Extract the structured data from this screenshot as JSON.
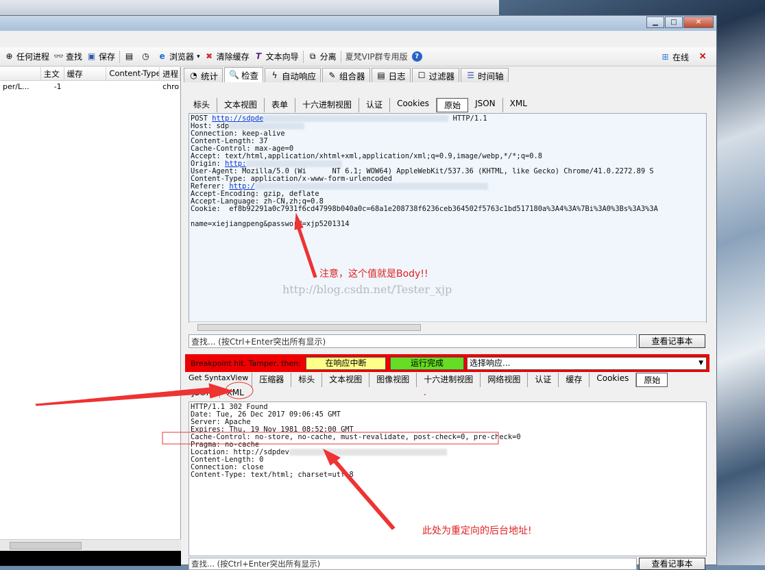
{
  "toolbar": {
    "items": [
      {
        "label": "任何进程",
        "icon": "crosshair-icon"
      },
      {
        "label": "查找",
        "icon": "binoculars-icon"
      },
      {
        "label": "保存",
        "icon": "save-icon"
      },
      {
        "label": "",
        "icon": "screenshot-icon"
      },
      {
        "label": "",
        "icon": "timer-icon"
      },
      {
        "label": "浏览器",
        "icon": "ie-icon"
      },
      {
        "label": "清除缓存",
        "icon": "clear-cache-icon"
      },
      {
        "label": "文本向导",
        "icon": "text-wizard-icon"
      },
      {
        "label": "分离",
        "icon": "detach-icon"
      },
      {
        "label": "夏梵VIP群专用版",
        "icon": ""
      },
      {
        "label": "",
        "icon": "help-icon"
      }
    ],
    "online_label": "在线",
    "close_x": "×"
  },
  "session_list": {
    "columns": [
      "主文",
      "缓存",
      "Content-Type",
      "进程"
    ],
    "rows": [
      {
        "url": "per/L...",
        "body": "-1",
        "caching": "",
        "ctype": "",
        "process": "chro"
      }
    ]
  },
  "inspector_tabs": [
    {
      "label": "统计",
      "icon": "stopwatch-icon"
    },
    {
      "label": "检查",
      "icon": "magnifier-icon",
      "active": true
    },
    {
      "label": "自动响应",
      "icon": "lightning-icon"
    },
    {
      "label": "组合器",
      "icon": "composer-icon"
    },
    {
      "label": "日志",
      "icon": "log-icon"
    },
    {
      "label": "过滤器",
      "icon": "checkbox-icon"
    },
    {
      "label": "时间轴",
      "icon": "timeline-icon"
    }
  ],
  "request_subtabs": [
    "标头",
    "文本视图",
    "表单",
    "十六进制视图",
    "认证",
    "Cookies",
    "原始",
    "JSON",
    "XML"
  ],
  "request_active": "原始",
  "request_raw": {
    "line1_method": "POST",
    "line1_url": "http://sdpde",
    "line1_proto": "HTTP/1.1",
    "line2": "Host: sdp",
    "line3": "Connection: keep-alive",
    "line4": "Content-Length: 37",
    "line5": "Cache-Control: max-age=0",
    "line6": "Accept: text/html,application/xhtml+xml,application/xml;q=0.9,image/webp,*/*;q=0.8",
    "line7_label": "Origin:",
    "line7_url": "http:",
    "line8": "User-Agent: Mozilla/5.0 (Wi      NT 6.1; WOW64) AppleWebKit/537.36 (KHTML, like Gecko) Chrome/41.0.2272.89 S",
    "line9": "Content-Type: application/x-www-form-urlencoded",
    "line10_label": "Referer:",
    "line10_url": "http:/",
    "line11": "Accept-Encoding: gzip, deflate",
    "line12": "Accept-Language: zh-CN,zh;q=0.8",
    "line13": "Cookie:  ef8b92291a0c7931f6cd47998b040a0c=68a1e208738f6236ceb364502f5763c1bd517180a%3A4%3A%7Bi%3A0%3Bs%3A3%3A",
    "body": "name=xiejiangpeng&password=xjp5201314"
  },
  "find_placeholder": "查找... (按Ctrl+Enter突出所有显示)",
  "view_notepad": "查看记事本",
  "breakpoint": {
    "text": "Breakpoint hit. Tamper, then:",
    "break_on_response": "在响应中断",
    "run_to_completion": "运行完成",
    "choose_response": "选择响应..."
  },
  "response_subtabs": [
    "Get SyntaxView",
    "压缩器",
    "标头",
    "文本视图",
    "图像视图",
    "十六进制视图",
    "网络视图",
    "认证",
    "缓存",
    "Cookies",
    "原始"
  ],
  "response_subtabs2": [
    "JSON",
    "XML"
  ],
  "response_active": "原始",
  "response_raw": {
    "line1_a": "HTTP/1.1",
    "line1_b": "302",
    "line1_c": "Found",
    "line2": "Date: Tue, 26 Dec 2017 09:06:45 GMT",
    "line3": "Server: Apache",
    "line4": "Expires: Thu, 19 Nov 1981 08:52:00 GMT",
    "line5": "Cache-Control: no-store, no-cache, must-revalidate, post-check=0, pre-check=0",
    "line6": "Pragma: no-cache",
    "line7": "Location: http://sdpdev",
    "line8": "Content-Length: 0",
    "line9": "Connection: close",
    "line10": "Content-Type: text/html; charset=utf-8"
  },
  "annotations": {
    "body_note": "注意，这个值就是Body!!",
    "redirect_note": "此处为重定向的后台地址!",
    "watermark": "http://blog.csdn.net/Tester_xjp"
  }
}
